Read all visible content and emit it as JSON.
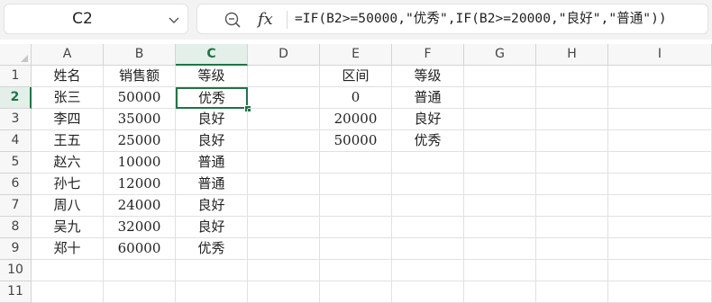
{
  "name_box": {
    "value": "C2"
  },
  "formula_bar": {
    "fx_label": "fx",
    "formula": "=IF(B2>=50000,\"优秀\",IF(B2>=20000,\"良好\",\"普通\"))"
  },
  "sheet": {
    "columns": [
      "A",
      "B",
      "C",
      "D",
      "E",
      "F",
      "G",
      "H",
      "I"
    ],
    "rows": [
      "1",
      "2",
      "3",
      "4",
      "5",
      "6",
      "7",
      "8",
      "9",
      "10",
      "11"
    ],
    "selected_cell": "C2",
    "cells": {
      "A1": "姓名",
      "B1": "销售额",
      "C1": "等级",
      "E1": "区间",
      "F1": "等级",
      "A2": "张三",
      "B2": "50000",
      "C2": "优秀",
      "E2": "0",
      "F2": "普通",
      "A3": "李四",
      "B3": "35000",
      "C3": "良好",
      "E3": "20000",
      "F3": "良好",
      "A4": "王五",
      "B4": "25000",
      "C4": "良好",
      "E4": "50000",
      "F4": "优秀",
      "A5": "赵六",
      "B5": "10000",
      "C5": "普通",
      "A6": "孙七",
      "B6": "12000",
      "C6": "普通",
      "A7": "周八",
      "B7": "24000",
      "C7": "良好",
      "A8": "吴九",
      "B8": "32000",
      "C8": "良好",
      "A9": "郑十",
      "B9": "60000",
      "C9": "优秀"
    }
  },
  "colors": {
    "accent": "#217346",
    "header_bg": "#f7f7f7",
    "gridline": "#e1e1e1"
  },
  "icons": {
    "name_box_dropdown": "chevron-down-icon",
    "zoom": "zoom-icon"
  }
}
